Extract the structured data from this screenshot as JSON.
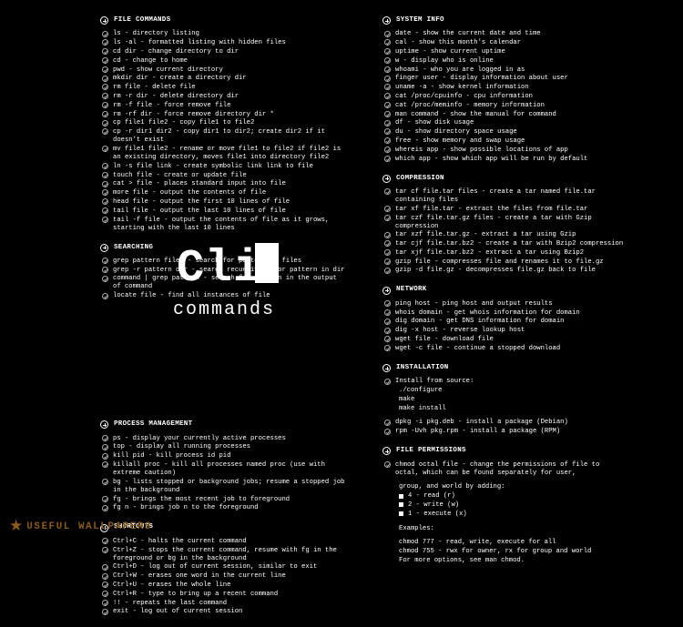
{
  "logo": {
    "main_pre": "Cli",
    "sub": "commands"
  },
  "footer": "USEFUL WALLPAPERS",
  "left": [
    {
      "title": "FILE COMMANDS",
      "items": [
        "ls - directory listing",
        "ls -al - formatted listing with hidden files",
        "cd dir - change directory to dir",
        "cd - change to home",
        "pwd - show current directory",
        "mkdir dir - create a directory dir",
        "rm file - delete file",
        "rm -r dir - delete directory dir",
        "rm -f file - force remove file",
        "rm -rf dir - force remove directory dir *",
        "cp file1 file2 - copy file1 to file2",
        "cp -r dir1 dir2 - copy dir1 to dir2; create dir2 if it doesn't exist",
        "mv file1 file2 - rename or move file1 to file2 if file2 is an existing directory, moves file1 into directory file2",
        "ln -s file link - create symbolic link link to file",
        "touch file - create or update file",
        "cat > file - places standard input into file",
        "more file - output the contents of file",
        "head file - output the first 10 lines of file",
        "tail file - output the last 10 lines of file",
        "tail -f file - output the contents of file as it grows, starting with the last 10 lines"
      ]
    },
    {
      "title": "SEARCHING",
      "items": [
        "grep pattern files - search for pattern in files",
        "grep -r pattern dir - search recursively for pattern in dir",
        "command | grep pattern - search for pattern in the output of command",
        "locate file - find all instances of file"
      ]
    },
    {
      "title": "PROCESS MANAGEMENT",
      "items": [
        "ps - display your currently active processes",
        "top - display all running processes",
        "kill pid - kill process id pid",
        "killall proc - kill all processes named proc (use with extreme caution)",
        "bg - lists stopped or background jobs; resume a stopped job in the background",
        "fg - brings the most recent job to foreground",
        "fg n - brings job n to the foreground"
      ]
    },
    {
      "title": "SHORTCUTS",
      "items": [
        "Ctrl+C - halts the current command",
        "Ctrl+Z - stops the current command, resume with fg in the foreground or bg in the background",
        "Ctrl+D - log out of current session, similar to exit",
        "Ctrl+W - erases one word in the current line",
        "Ctrl+U - erases the whole line",
        "Ctrl+R - type to bring up a recent command",
        "!! - repeats the last command",
        "exit - log out of current session"
      ]
    }
  ],
  "right": [
    {
      "title": "SYSTEM INFO",
      "items": [
        "date - show the current date and time",
        "cal - show this month's calendar",
        "uptime - show current uptime",
        "w - display who is online",
        "whoami - who you are logged in as",
        "finger user - display information about user",
        "uname -a - show kernel information",
        "cat /proc/cpuinfo - cpu information",
        "cat /proc/meminfo - memory information",
        "man command - show the manual for command",
        "df - show disk usage",
        "du - show directory space usage",
        "free - show memory and swap usage",
        "whereis app - show possible locations of app",
        "which app - show which app will be run by default"
      ]
    },
    {
      "title": "COMPRESSION",
      "items": [
        "tar cf file.tar files - create a tar named file.tar containing files",
        "tar xf file.tar - extract the files from file.tar",
        "tar czf file.tar.gz files - create a tar with Gzip compression",
        "tar xzf file.tar.gz - extract a tar using Gzip",
        "tar cjf file.tar.bz2 - create a tar with Bzip2 compression",
        "tar xjf file.tar.bz2 - extract a tar using Bzip2",
        "gzip file - compresses file and renames it to file.gz",
        "gzip -d file.gz - decompresses file.gz back to file"
      ]
    },
    {
      "title": "NETWORK",
      "items": [
        "ping host - ping host and output results",
        "whois domain - get whois information for domain",
        "dig domain - get DNS information for domain",
        "dig -x host - reverse lookup host",
        "wget file - download file",
        "wget -c file - continue a stopped download"
      ]
    },
    {
      "title": "INSTALLATION",
      "type": "install",
      "items": [
        "Install from source:",
        "./configure",
        "make",
        "make install"
      ],
      "items2": [
        "dpkg -i pkg.deb - install a package (Debian)",
        "rpm -Uvh pkg.rpm - install a package (RPM)"
      ]
    },
    {
      "title": "FILE PERMISSIONS",
      "type": "perm",
      "lead": "chmod octal file - change the permissions of file to octal, which can be found separately for user,",
      "mid": "group, and world by adding:",
      "bullets": [
        "4 - read (r)",
        "2 - write (w)",
        "1 - execute (x)"
      ],
      "ex_label": "Examples:",
      "ex": [
        "chmod 777 - read, write, execute for all",
        "chmod 755 - rwx for owner, rx for group and world",
        "For more options, see man chmod."
      ]
    }
  ]
}
